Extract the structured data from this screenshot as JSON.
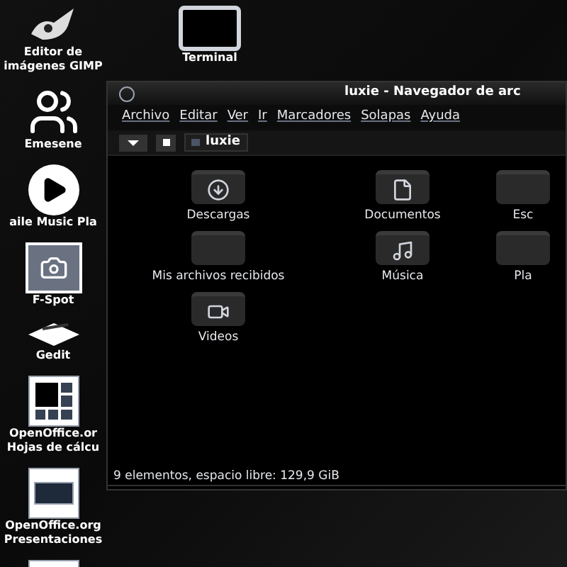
{
  "desktop_icons": [
    {
      "kind": "gimp",
      "lines": [
        "Editor de",
        "imágenes GIMP"
      ]
    },
    {
      "kind": "chat",
      "lines": [
        "Emesene"
      ]
    },
    {
      "kind": "play",
      "lines": [
        "aile Music Pla"
      ]
    },
    {
      "kind": "photo",
      "lines": [
        "F-Spot"
      ]
    },
    {
      "kind": "editor",
      "lines": [
        "Gedit"
      ]
    },
    {
      "kind": "sheet",
      "lines": [
        "OpenOffice.or",
        "Hojas de cálcu"
      ]
    },
    {
      "kind": "slides",
      "lines": [
        "OpenOffice.org",
        "Presentaciones"
      ]
    },
    {
      "kind": "writer"
    }
  ],
  "desktop_icons_2": [
    {
      "kind": "terminal",
      "lines": [
        "Terminal"
      ]
    }
  ],
  "window": {
    "title": "luxie - Navegador de arc",
    "menu": [
      "Archivo",
      "Editar",
      "Ver",
      "Ir",
      "Marcadores",
      "Solapas",
      "Ayuda"
    ],
    "location": "luxie",
    "folders": [
      {
        "kind": "download",
        "label": "Descargas"
      },
      {
        "kind": "document",
        "label": "Documentos"
      },
      {
        "kind": "plain",
        "label": "Esc"
      },
      {
        "kind": "plain",
        "label": "Mis archivos recibidos"
      },
      {
        "kind": "music",
        "label": "Música"
      },
      {
        "kind": "plain",
        "label": "Pla"
      },
      {
        "kind": "video",
        "label": "Videos"
      }
    ],
    "status_bar": "9 elementos, espacio libre: 129,9 GiB"
  }
}
